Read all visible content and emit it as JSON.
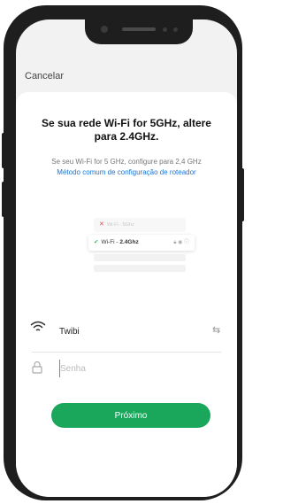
{
  "header": {
    "cancel_label": "Cancelar"
  },
  "intro": {
    "title": "Se sua rede Wi-Fi for 5GHz, altere para 2.4GHz.",
    "subtitle": "Se seu Wi-Fi for 5 GHz, configure para 2,4 GHz",
    "link": "Método comum de configuração de roteador"
  },
  "illustration": {
    "row_5g": {
      "prefix": "Wi-Fi - ",
      "network": "5Ghz",
      "icon": "x-icon"
    },
    "row_24g": {
      "prefix": "Wi-Fi - ",
      "network": "2.4Ghz",
      "icon": "check-icon"
    }
  },
  "form": {
    "ssid": "Twibi",
    "password_placeholder": "Senha",
    "password_value": ""
  },
  "action": {
    "next_label": "Próximo"
  },
  "colors": {
    "accent": "#1aa75c",
    "link": "#1b74d1",
    "error": "#e04a4a"
  }
}
